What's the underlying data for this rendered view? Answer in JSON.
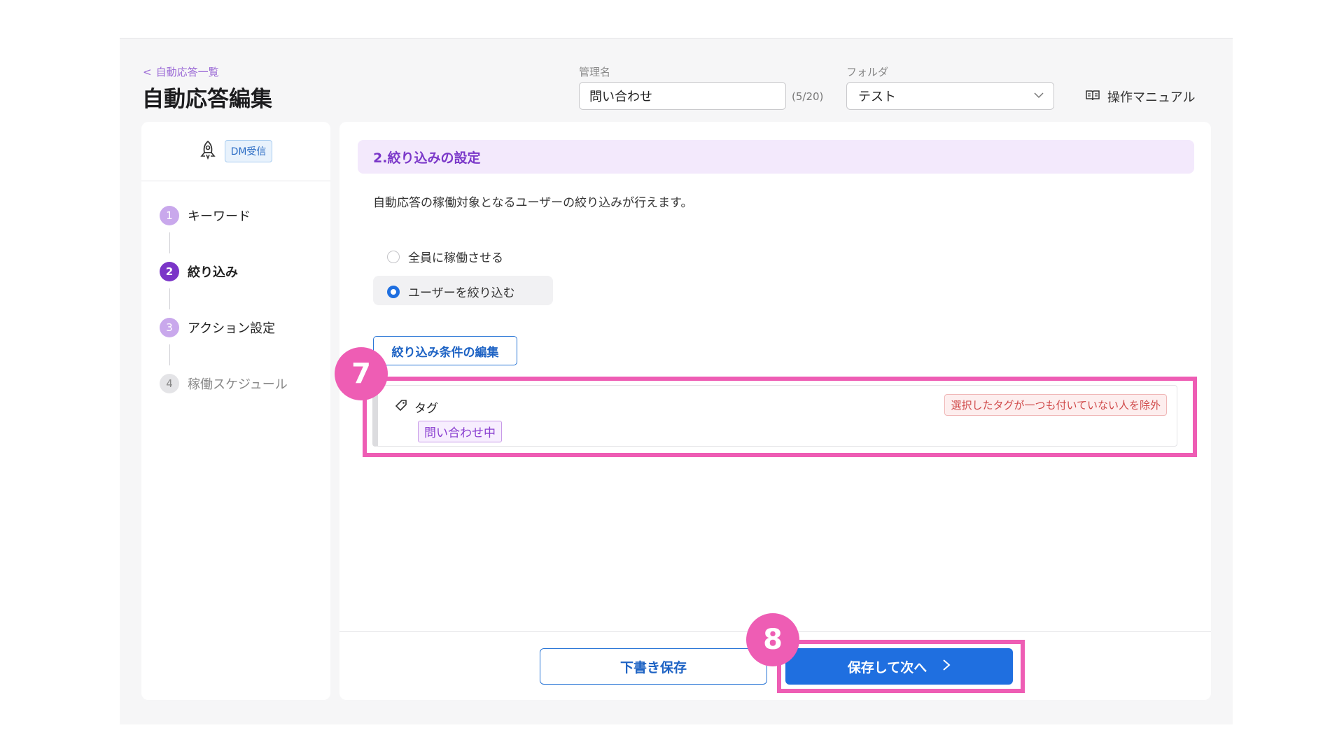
{
  "header": {
    "back_label": "自動応答一覧",
    "title": "自動応答編集",
    "name_label": "管理名",
    "name_value": "問い合わせ",
    "name_counter": "(5/20)",
    "folder_label": "フォルダ",
    "folder_value": "テスト",
    "manual_label": "操作マニュアル"
  },
  "sidebar": {
    "trigger_badge": "DM受信",
    "steps": [
      {
        "num": "1",
        "label": "キーワード"
      },
      {
        "num": "2",
        "label": "絞り込み"
      },
      {
        "num": "3",
        "label": "アクション設定"
      },
      {
        "num": "4",
        "label": "稼働スケジュール"
      }
    ]
  },
  "main": {
    "section_title": "2.絞り込みの設定",
    "description": "自動応答の稼働対象となるユーザーの絞り込みが行えます。",
    "radio_options": [
      {
        "label": "全員に稼働させる",
        "selected": false
      },
      {
        "label": "ユーザーを絞り込む",
        "selected": true
      }
    ],
    "edit_button": "絞り込み条件の編集",
    "tag_card": {
      "title": "タグ",
      "exclude_badge": "選択したタグが一つも付いていない人を除外",
      "tag_chip": "問い合わせ中"
    },
    "footer": {
      "draft_button": "下書き保存",
      "next_button": "保存して次へ",
      "next_chevron": "＞"
    }
  },
  "annotations": {
    "callout_7": "7",
    "callout_8": "8",
    "highlight_color": "#ee5db4"
  },
  "colors": {
    "accent_purple": "#7b38c9",
    "primary_blue": "#1f6fe0",
    "step_active": "#7b35c8",
    "step_inactive": "#c9a8ec",
    "step_disabled": "#cfcfd4"
  }
}
